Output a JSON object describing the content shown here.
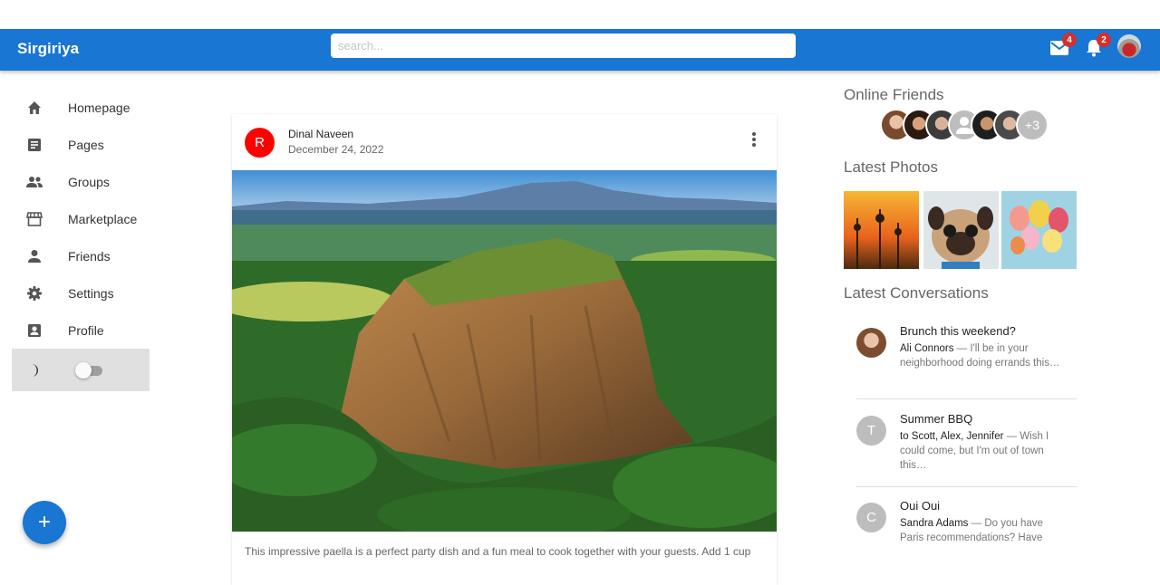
{
  "header": {
    "brand": "Sirgiriya",
    "search_placeholder": "search...",
    "mail_badge": "4",
    "notifications_badge": "2",
    "colors": {
      "primary": "#1976d2",
      "badge": "#d32f2f"
    }
  },
  "sidebar": {
    "items": [
      {
        "label": "Homepage",
        "icon": "home-icon"
      },
      {
        "label": "Pages",
        "icon": "article-icon"
      },
      {
        "label": "Groups",
        "icon": "group-icon"
      },
      {
        "label": "Marketplace",
        "icon": "storefront-icon"
      },
      {
        "label": "Friends",
        "icon": "person-icon"
      },
      {
        "label": "Settings",
        "icon": "settings-icon"
      },
      {
        "label": "Profile",
        "icon": "account-box-icon"
      }
    ],
    "dark_mode_toggle": {
      "icon": "moon-icon",
      "checked": false
    }
  },
  "fab": {
    "label": "+"
  },
  "post": {
    "avatar_letter": "R",
    "author": "Dinal Naveen",
    "date": "December 24, 2022",
    "avatar_color": "#ff0000",
    "text": "This impressive paella is a perfect party dish and a fun meal to cook together with your guests. Add 1 cup"
  },
  "right": {
    "online_title": "Online Friends",
    "online_more": "+3",
    "photos_title": "Latest Photos",
    "conversations_title": "Latest Conversations",
    "conversations": [
      {
        "avatar_letter": "",
        "title": "Brunch this weekend?",
        "from": "Ali Connors",
        "message": " — I'll be in your neighborhood doing errands this…"
      },
      {
        "avatar_letter": "T",
        "title": "Summer BBQ",
        "from": "to Scott, Alex, Jennifer",
        "message": " — Wish I could come, but I'm out of town this…"
      },
      {
        "avatar_letter": "C",
        "title": "Oui Oui",
        "from": "Sandra Adams",
        "message": " — Do you have Paris recommendations? Have"
      }
    ]
  }
}
